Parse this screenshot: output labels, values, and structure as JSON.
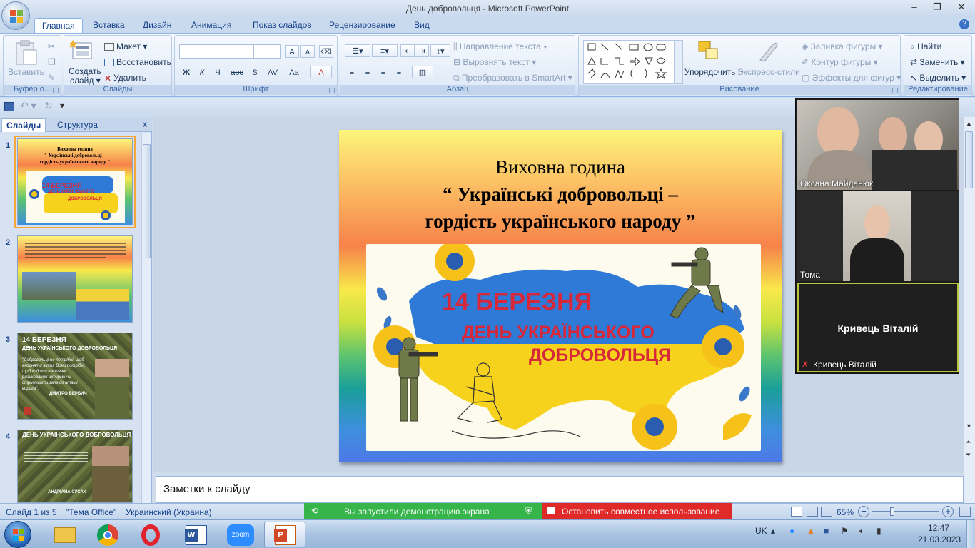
{
  "window": {
    "title": "День добровольця - Microsoft PowerPoint",
    "minimize": "–",
    "restore": "❐",
    "close": "✕"
  },
  "tabs": [
    "Главная",
    "Вставка",
    "Дизайн",
    "Анимация",
    "Показ слайдов",
    "Рецензирование",
    "Вид"
  ],
  "ribbon": {
    "clipboard": {
      "paste": "Вставить",
      "group": "Буфер о..."
    },
    "slides": {
      "new_slide_1": "Создать",
      "new_slide_2": "слайд",
      "layout": "Макет",
      "reset": "Восстановить",
      "delete": "Удалить",
      "group": "Слайды"
    },
    "font": {
      "group": "Шрифт",
      "bold": "Ж",
      "italic": "К",
      "underline": "Ч",
      "strike": "abc",
      "shadow": "S",
      "spacing": "AV",
      "case": "Aa",
      "color": "A",
      "grow": "A",
      "shrink": "A"
    },
    "paragraph": {
      "text_direction": "Направление текста",
      "align_text": "Выровнять текст",
      "smartart": "Преобразовать в SmartArt",
      "group": "Абзац"
    },
    "drawing": {
      "arrange": "Упорядочить",
      "quick_styles": "Экспресс-стили",
      "fill": "Заливка фигуры",
      "outline": "Контур фигуры",
      "effects": "Эффекты для фигур",
      "group": "Рисование"
    },
    "editing": {
      "find": "Найти",
      "replace": "Заменить",
      "select": "Выделить",
      "group": "Редактирование"
    }
  },
  "left_pane": {
    "tab_slides": "Слайды",
    "tab_outline": "Структура",
    "close": "x",
    "thumbs": [
      {
        "num": "1",
        "lines": [
          "Виховна година",
          "\" Українські добровольці –",
          "гордість українського народу \""
        ],
        "banner1": "14 БЕРЕЗНЯ",
        "banner2": "ДЕНЬ УКРАЇНСЬКОГО",
        "banner3": "ДОБРОВОЛЬЦЯ"
      },
      {
        "num": "2"
      },
      {
        "num": "3",
        "head1": "14 БЕРЕЗНЯ",
        "head2": "ДЕНЬ УКРАЇНСЬКОГО ДОБРОВОЛЬЦЯ",
        "quote": "\"Добровольці не потрібні, щоб екорняти акти. Вони потрібні, щоб ходити в кривавi ризикований штурми чи стримувати залеклі атаки ворога\".",
        "author": "ДМИТРО ВЕРБИЧ"
      },
      {
        "num": "4",
        "head": "ДЕНЬ УКРАЇНСЬКОГО ДОБРОВОЛЬЦЯ",
        "author": "АНДРІАНА СУСАК"
      }
    ]
  },
  "slide": {
    "title_1": "Виховна година",
    "title_2": "“ Українські добровольці –",
    "title_3": "гордість українського  народу ”",
    "banner_1": "14 БЕРЕЗНЯ",
    "banner_2": "ДЕНЬ УКРАЇНСЬКОГО",
    "banner_3": "ДОБРОВОЛЬЦЯ"
  },
  "notes": {
    "placeholder": "Заметки к слайду"
  },
  "status": {
    "slide": "Слайд 1 из 5",
    "theme": "\"Тема Office\"",
    "language": "Украинский (Украина)",
    "zoom": "65%",
    "zoom_minus": "−",
    "zoom_plus": "+"
  },
  "share": {
    "demo": "Вы запустили демонстрацию экрана",
    "stop": "Остановить совместное использование"
  },
  "zoom": {
    "participants": [
      {
        "name": "Оксана Майданюк"
      },
      {
        "name": "Тома"
      },
      {
        "name": "Кривець Віталій",
        "center_name": "Кривець Віталій"
      }
    ]
  },
  "taskbar": {
    "lang": "UK",
    "time": "12:47",
    "date": "21.03.2023"
  },
  "colors": {
    "ribbon_accent": "#15428b",
    "share_green": "#35b54a",
    "share_red": "#e02a2a",
    "banner_red": "#d6283a"
  }
}
